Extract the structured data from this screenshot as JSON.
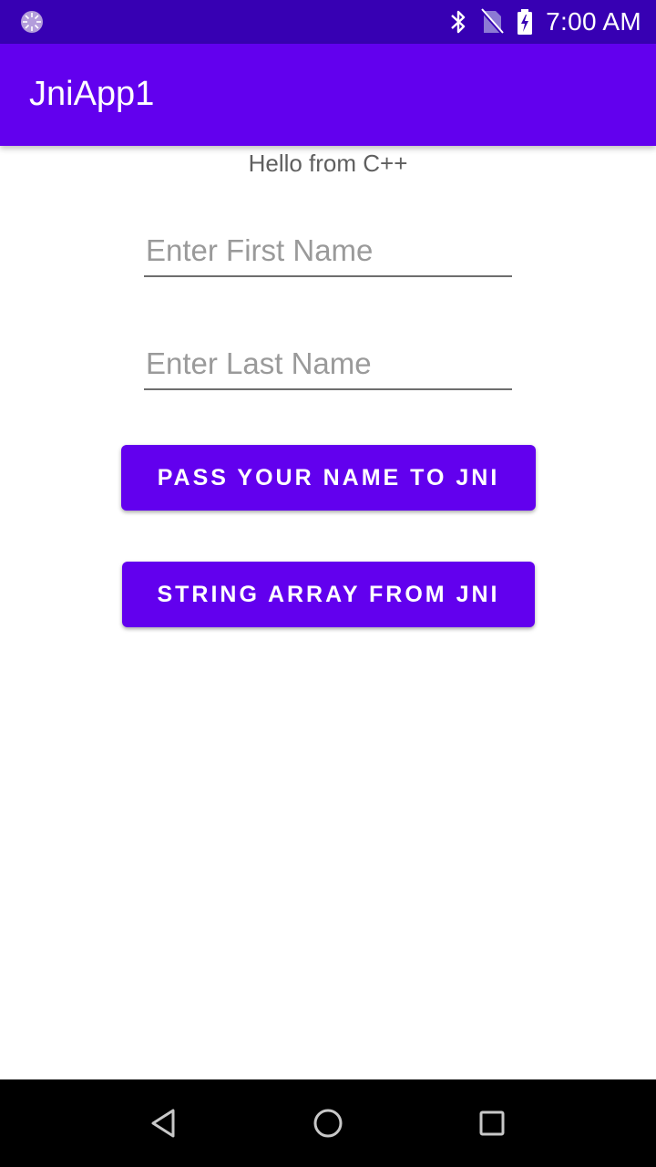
{
  "status_bar": {
    "time": "7:00 AM",
    "icons": [
      "loading-icon",
      "bluetooth-icon",
      "no-sim-icon",
      "battery-charging-icon"
    ]
  },
  "app_bar": {
    "title": "JniApp1"
  },
  "main": {
    "hello_text": "Hello from C++",
    "first_name": {
      "value": "",
      "placeholder": "Enter First Name"
    },
    "last_name": {
      "value": "",
      "placeholder": "Enter Last Name"
    },
    "pass_name_button": "PASS YOUR NAME TO JNI",
    "string_array_button": "STRING ARRAY FROM JNI"
  },
  "nav_bar": {
    "icons": [
      "back-icon",
      "home-icon",
      "recents-icon"
    ]
  },
  "colors": {
    "status_bar": "#3700B3",
    "primary": "#6200EE",
    "nav_bar": "#000000"
  }
}
